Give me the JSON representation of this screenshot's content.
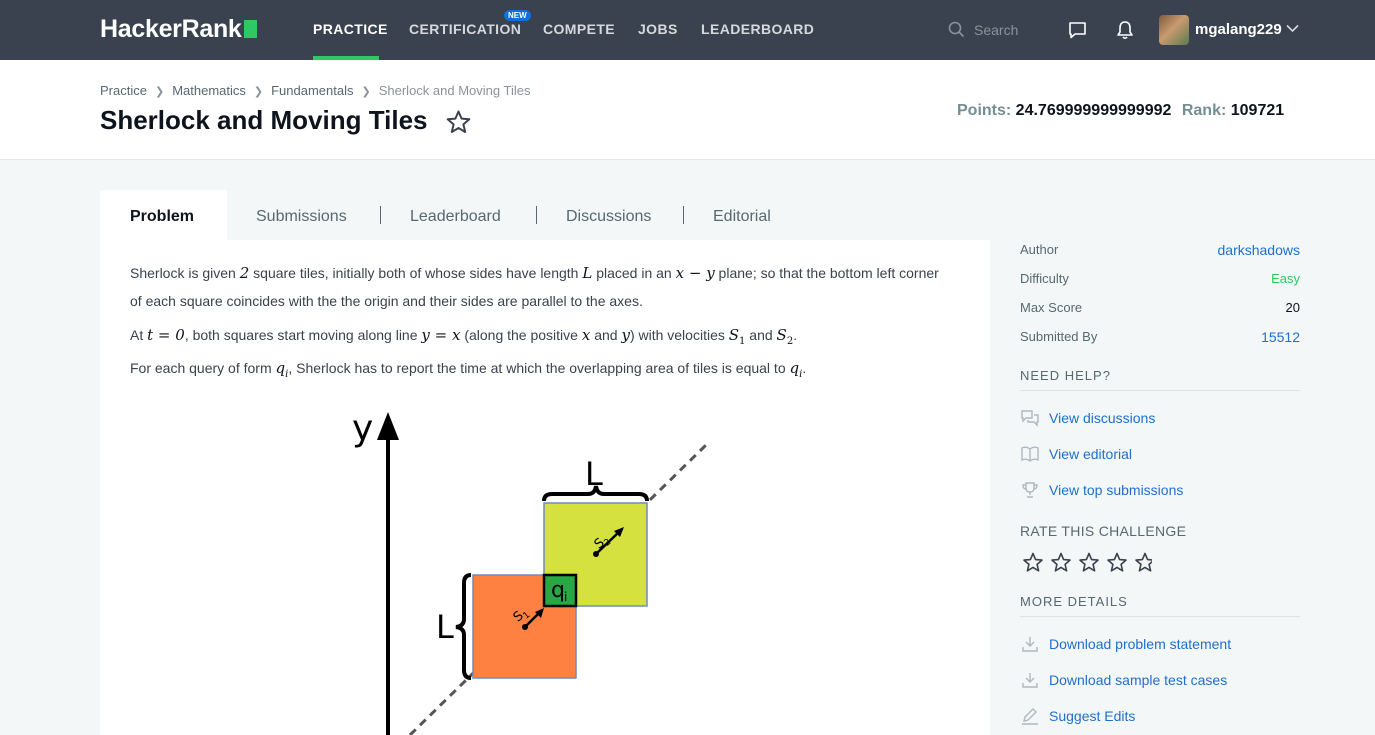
{
  "nav": {
    "logo": "HackerRank",
    "links": [
      "PRACTICE",
      "CERTIFICATION",
      "COMPETE",
      "JOBS",
      "LEADERBOARD"
    ],
    "new_badge": "NEW",
    "search_placeholder": "Search",
    "username": "mgalang229"
  },
  "breadcrumb": [
    "Practice",
    "Mathematics",
    "Fundamentals",
    "Sherlock and Moving Tiles"
  ],
  "title": "Sherlock and Moving Tiles",
  "stats": {
    "points_label": "Points:",
    "points_value": "24.769999999999992",
    "rank_label": "Rank:",
    "rank_value": "109721"
  },
  "tabs": [
    "Problem",
    "Submissions",
    "Leaderboard",
    "Discussions",
    "Editorial"
  ],
  "problem": {
    "p1a": "Sherlock is given ",
    "p1_n": "2",
    "p1b": " square tiles, initially both of whose sides have length ",
    "p1_L": "L",
    "p1c": " placed in an ",
    "p1_xy": "x − y",
    "p1d": " plane; so that the bottom left corner of each square coincides with the the origin and their sides are parallel to the axes.",
    "p2a": "At ",
    "p2_t": "t = 0",
    "p2b": ", both squares start moving along line ",
    "p2_line": "y = x",
    "p2c": " (along the positive ",
    "p2_x": "x",
    "p2d": " and ",
    "p2_y": "y",
    "p2e": ") with velocities ",
    "p2_s1": "S",
    "p2_s1sub": "1",
    "p2f": " and ",
    "p2_s2": "S",
    "p2_s2sub": "2",
    "p2g": ".",
    "p3a": "For each query of form ",
    "p3_q": "q",
    "p3_qsub": "i",
    "p3b": ", Sherlock has to report the time at which the overlapping area of tiles is equal to ",
    "p3_q2": "q",
    "p3_q2sub": "i",
    "p3c": "."
  },
  "diagram": {
    "axis_label": "y",
    "top_label": "L",
    "left_label": "L",
    "q_label": "q",
    "q_sub": "i",
    "s1_label": "S",
    "s1_sub": "1",
    "s2_label": "S",
    "s2_sub": "2",
    "colors": {
      "square1": "#fe8142",
      "square2": "#d4e13e",
      "overlap": "#29a744"
    }
  },
  "sidebar": {
    "rows": [
      {
        "label": "Author",
        "value": "darkshadows"
      },
      {
        "label": "Difficulty",
        "value": "Easy"
      },
      {
        "label": "Max Score",
        "value": "20"
      },
      {
        "label": "Submitted By",
        "value": "15512"
      }
    ],
    "need_help": "NEED HELP?",
    "help_links": [
      "View discussions",
      "View editorial",
      "View top submissions"
    ],
    "rate_heading": "RATE THIS CHALLENGE",
    "more_heading": "MORE DETAILS",
    "more_links": [
      "Download problem statement",
      "Download sample test cases",
      "Suggest Edits"
    ]
  },
  "colors": {
    "nav_bg": "#39424e",
    "accent_green": "#2ec866",
    "link_blue": "#1f6fd0"
  }
}
